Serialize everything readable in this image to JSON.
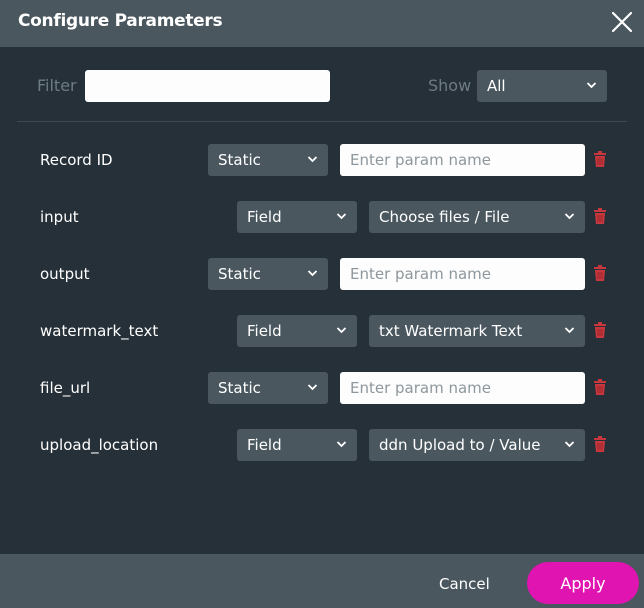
{
  "dialog": {
    "title": "Configure Parameters",
    "close_icon": "close-icon"
  },
  "filter": {
    "label": "Filter",
    "value": "",
    "placeholder": ""
  },
  "show": {
    "label": "Show",
    "selected": "All"
  },
  "params": [
    {
      "name": "Record ID",
      "type": "Static",
      "value": "",
      "placeholder": "Enter param name"
    },
    {
      "name": "input",
      "type": "Field",
      "value": "Choose files / File"
    },
    {
      "name": "output",
      "type": "Static",
      "value": "",
      "placeholder": "Enter param name"
    },
    {
      "name": "watermark_text",
      "type": "Field",
      "value": "txt Watermark Text"
    },
    {
      "name": "file_url",
      "type": "Static",
      "value": "",
      "placeholder": "Enter param name"
    },
    {
      "name": "upload_location",
      "type": "Field",
      "value": "ddn Upload to / Value"
    }
  ],
  "footer": {
    "cancel_label": "Cancel",
    "apply_label": "Apply"
  },
  "colors": {
    "header_bg": "#4a575f",
    "body_bg": "#263038",
    "accent": "#e014b0",
    "delete": "#c8373d"
  }
}
